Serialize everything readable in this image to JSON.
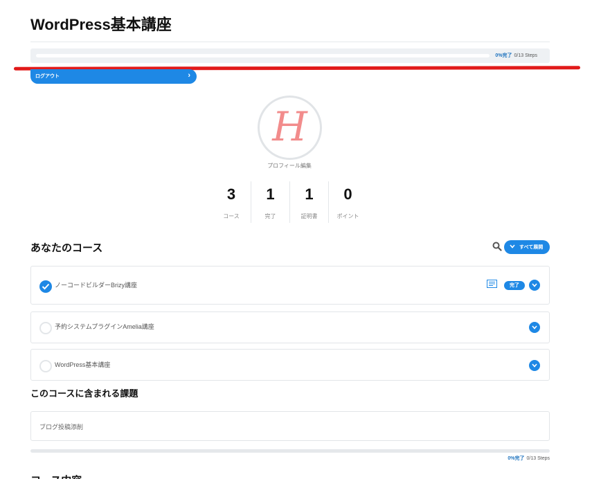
{
  "page": {
    "title": "WordPress基本講座"
  },
  "progress": {
    "percent_label": "0%完了",
    "steps_label": "0/13 Steps",
    "value": 0
  },
  "logout": {
    "label": "ログアウト",
    "chevron": "›"
  },
  "profile": {
    "avatar_letter": "H",
    "edit_label": "プロフィール編集"
  },
  "stats": [
    {
      "value": "3",
      "label": "コース"
    },
    {
      "value": "1",
      "label": "完了"
    },
    {
      "value": "1",
      "label": "証明書"
    },
    {
      "value": "0",
      "label": "ポイント"
    }
  ],
  "courses_section": {
    "title": "あなたのコース",
    "expand_all_label": "すべて展開",
    "icons": [
      "search-icon",
      "chevron-down-icon"
    ]
  },
  "courses": [
    {
      "name": "ノーコードビルダーBrizy講座",
      "status": "done",
      "badge": "完了"
    },
    {
      "name": "予約システムプラグインAmelia講座",
      "status": "todo"
    },
    {
      "name": "WordPress基本講座",
      "status": "todo"
    }
  ],
  "assignments_section": {
    "title": "このコースに含まれる課題",
    "items": [
      {
        "name": "ブログ投稿添削"
      }
    ]
  },
  "progress_bottom": {
    "percent_label": "0%完了",
    "steps_label": "0/13 Steps",
    "value": 0
  },
  "next_section": {
    "title": "コース内容"
  },
  "colors": {
    "accent": "#1e88e5",
    "annotation_red": "#e11a1a",
    "avatar_pink": "#f28c8c"
  }
}
